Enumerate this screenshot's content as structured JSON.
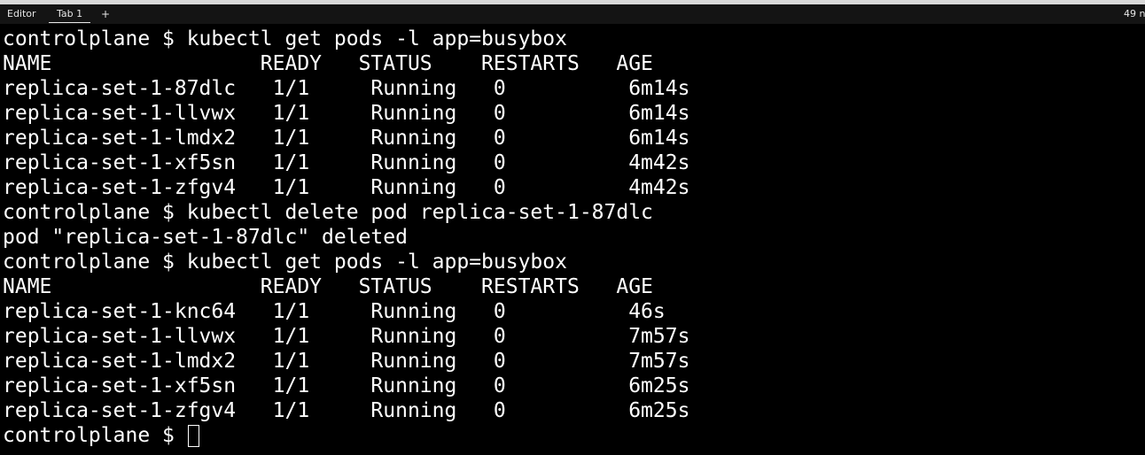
{
  "tabbar": {
    "editor_label": "Editor",
    "tab_label": "Tab 1",
    "new_tab_label": "+",
    "timer_text": "49 n"
  },
  "terminal": {
    "lines": [
      "controlplane $ kubectl get pods -l app=busybox",
      "NAME                 READY   STATUS    RESTARTS   AGE",
      "replica-set-1-87dlc   1/1     Running   0          6m14s",
      "replica-set-1-llvwx   1/1     Running   0          6m14s",
      "replica-set-1-lmdx2   1/1     Running   0          6m14s",
      "replica-set-1-xf5sn   1/1     Running   0          4m42s",
      "replica-set-1-zfgv4   1/1     Running   0          4m42s",
      "controlplane $ kubectl delete pod replica-set-1-87dlc",
      "pod \"replica-set-1-87dlc\" deleted",
      "controlplane $ kubectl get pods -l app=busybox",
      "NAME                 READY   STATUS    RESTARTS   AGE",
      "replica-set-1-knc64   1/1     Running   0          46s",
      "replica-set-1-llvwx   1/1     Running   0          7m57s",
      "replica-set-1-lmdx2   1/1     Running   0          7m57s",
      "replica-set-1-xf5sn   1/1     Running   0          6m25s",
      "replica-set-1-zfgv4   1/1     Running   0          6m25s"
    ],
    "prompt": "controlplane $ "
  },
  "colors": {
    "background": "#000000",
    "foreground": "#ffffff",
    "tabbar_background": "#141414"
  }
}
